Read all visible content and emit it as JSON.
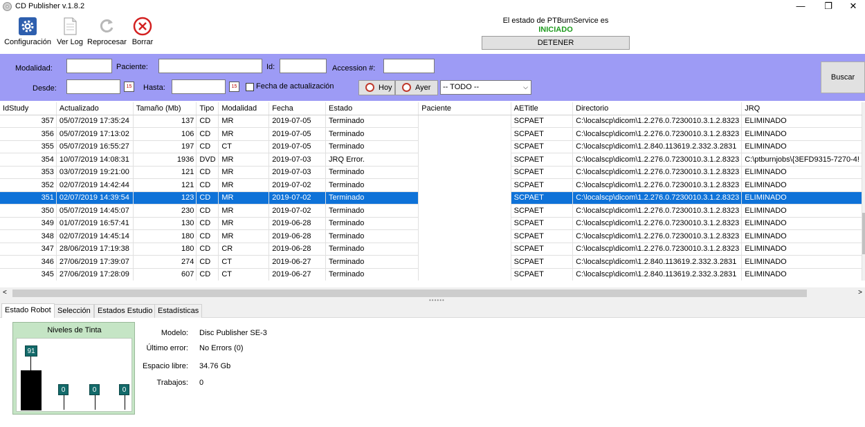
{
  "window": {
    "title": "CD Publisher v.1.8.2",
    "minimize": "—",
    "maximize": "❐",
    "close": "✕"
  },
  "toolbar": {
    "config_label": "Configuración",
    "log_label": "Ver Log",
    "reprocess_label": "Reprocesar",
    "delete_label": "Borrar"
  },
  "service": {
    "status_text": "El estado de PTBurnService es",
    "status_value": "INICIADO",
    "stop_label": "DETENER"
  },
  "filters": {
    "modalidad_label": "Modalidad:",
    "modalidad_value": "",
    "paciente_label": "Paciente:",
    "paciente_value": "",
    "id_label": "Id:",
    "id_value": "",
    "accession_label": "Accession #:",
    "accession_value": "",
    "desde_label": "Desde:",
    "desde_value": "",
    "hasta_label": "Hasta:",
    "hasta_value": "",
    "fecha_act_label": "Fecha de actualización",
    "hoy_label": "Hoy",
    "ayer_label": "Ayer",
    "scope_selected": "-- TODO --",
    "search_label": "Buscar",
    "calendar_glyph": "15"
  },
  "table": {
    "columns": [
      "IdStudy",
      "Actualizado",
      "Tamaño (Mb)",
      "Tipo",
      "Modalidad",
      "Fecha",
      "Estado",
      "Paciente",
      "AETitle",
      "Directorio",
      "JRQ"
    ],
    "rows": [
      [
        "357",
        "05/07/2019 17:35:24",
        "137",
        "CD",
        "MR",
        "2019-07-05",
        "Terminado",
        "",
        "SCPAET",
        "C:\\localscp\\dicom\\1.2.276.0.7230010.3.1.2.8323",
        "ELIMINADO"
      ],
      [
        "356",
        "05/07/2019 17:13:02",
        "106",
        "CD",
        "MR",
        "2019-07-05",
        "Terminado",
        "",
        "SCPAET",
        "C:\\localscp\\dicom\\1.2.276.0.7230010.3.1.2.8323",
        "ELIMINADO"
      ],
      [
        "355",
        "05/07/2019 16:55:27",
        "197",
        "CD",
        "CT",
        "2019-07-05",
        "Terminado",
        "",
        "SCPAET",
        "C:\\localscp\\dicom\\1.2.840.113619.2.332.3.2831",
        "ELIMINADO"
      ],
      [
        "354",
        "10/07/2019 14:08:31",
        "1936",
        "DVD",
        "MR",
        "2019-07-03",
        "JRQ Error.",
        "",
        "SCPAET",
        "C:\\localscp\\dicom\\1.2.276.0.7230010.3.1.2.8323",
        "C:\\ptburnjobs\\{3EFD9315-7270-4!"
      ],
      [
        "353",
        "03/07/2019 19:21:00",
        "121",
        "CD",
        "MR",
        "2019-07-03",
        "Terminado",
        "",
        "SCPAET",
        "C:\\localscp\\dicom\\1.2.276.0.7230010.3.1.2.8323",
        "ELIMINADO"
      ],
      [
        "352",
        "02/07/2019 14:42:44",
        "121",
        "CD",
        "MR",
        "2019-07-02",
        "Terminado",
        "",
        "SCPAET",
        "C:\\localscp\\dicom\\1.2.276.0.7230010.3.1.2.8323",
        "ELIMINADO"
      ],
      [
        "351",
        "02/07/2019 14:39:54",
        "123",
        "CD",
        "MR",
        "2019-07-02",
        "Terminado",
        "",
        "SCPAET",
        "C:\\localscp\\dicom\\1.2.276.0.7230010.3.1.2.8323",
        "ELIMINADO"
      ],
      [
        "350",
        "05/07/2019 14:45:07",
        "230",
        "CD",
        "MR",
        "2019-07-02",
        "Terminado",
        "",
        "SCPAET",
        "C:\\localscp\\dicom\\1.2.276.0.7230010.3.1.2.8323",
        "ELIMINADO"
      ],
      [
        "349",
        "01/07/2019 16:57:41",
        "130",
        "CD",
        "MR",
        "2019-06-28",
        "Terminado",
        "",
        "SCPAET",
        "C:\\localscp\\dicom\\1.2.276.0.7230010.3.1.2.8323",
        "ELIMINADO"
      ],
      [
        "348",
        "02/07/2019 14:45:14",
        "180",
        "CD",
        "MR",
        "2019-06-28",
        "Terminado",
        "",
        "SCPAET",
        "C:\\localscp\\dicom\\1.2.276.0.7230010.3.1.2.8323",
        "ELIMINADO"
      ],
      [
        "347",
        "28/06/2019 17:19:38",
        "180",
        "CD",
        "CR",
        "2019-06-28",
        "Terminado",
        "",
        "SCPAET",
        "C:\\localscp\\dicom\\1.2.276.0.7230010.3.1.2.8323",
        "ELIMINADO"
      ],
      [
        "346",
        "27/06/2019 17:39:07",
        "274",
        "CD",
        "CT",
        "2019-06-27",
        "Terminado",
        "",
        "SCPAET",
        "C:\\localscp\\dicom\\1.2.840.113619.2.332.3.2831",
        "ELIMINADO"
      ],
      [
        "345",
        "27/06/2019 17:28:09",
        "607",
        "CD",
        "CT",
        "2019-06-27",
        "Terminado",
        "",
        "SCPAET",
        "C:\\localscp\\dicom\\1.2.840.113619.2.332.3.2831",
        "ELIMINADO"
      ]
    ],
    "selected_index": 6,
    "scroll_left": "<",
    "scroll_right": ">",
    "splitter_grip": "••••••"
  },
  "tabs": [
    "Estado Robot",
    "Selección",
    "Estados Estudio",
    "Estadísticas"
  ],
  "robot": {
    "ink_title": "Niveles de Tinta",
    "ink_levels": [
      91,
      0,
      0,
      0
    ],
    "model_label": "Modelo:",
    "model_value": "Disc Publisher SE-3",
    "error_label": "Último error:",
    "error_value": "No Errors (0)",
    "space_label": "Espacio libre:",
    "space_value": "34.76 Gb",
    "jobs_label": "Trabajos:",
    "jobs_value": "0"
  },
  "colors": {
    "filter_bg": "#9d9bf5",
    "selected_row": "#0e72d8",
    "status_ok": "#1f9b1f",
    "ink_panel": "#c5e5c5",
    "ink_label": "#136a6a"
  }
}
